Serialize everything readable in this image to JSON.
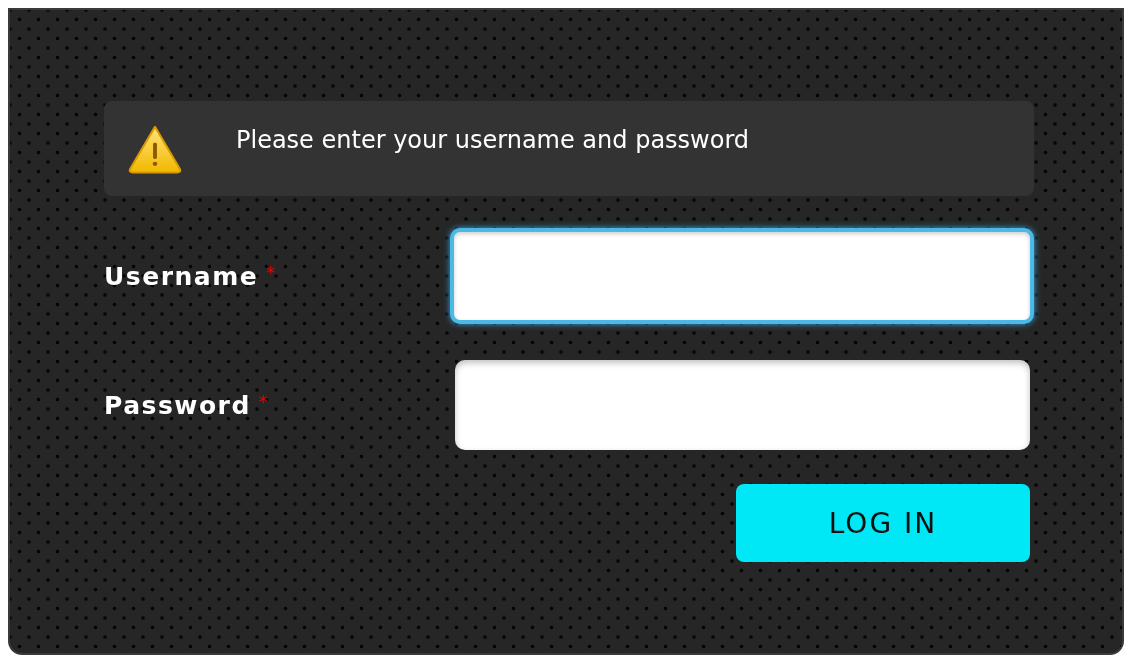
{
  "alert": {
    "kind": "warning",
    "message": "Please enter your username and password"
  },
  "fields": [
    {
      "label": "Username",
      "required_mark": "*",
      "focused": true
    },
    {
      "label": "Password",
      "required_mark": "*",
      "focused": false
    }
  ],
  "buttons": [
    {
      "label": "LOG IN"
    }
  ]
}
